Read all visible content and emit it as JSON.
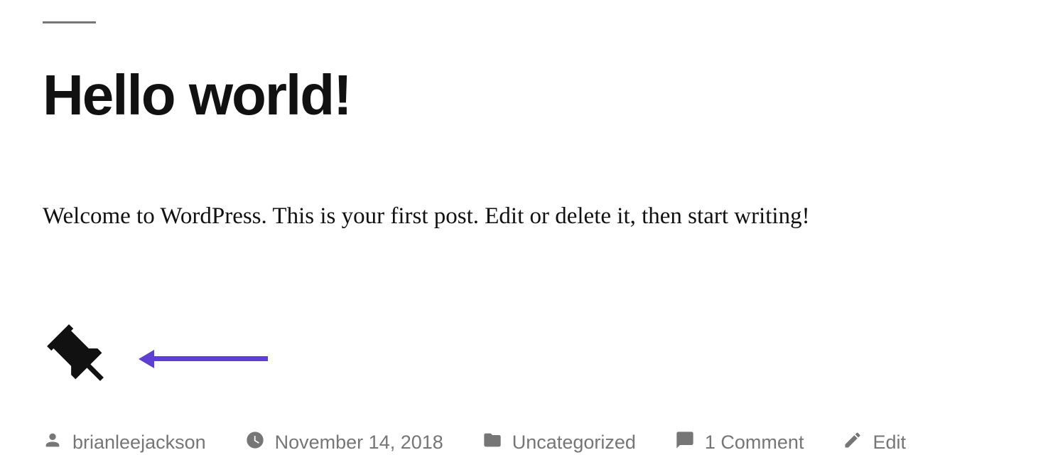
{
  "post": {
    "title": "Hello world!",
    "content": "Welcome to WordPress. This is your first post. Edit or delete it, then start writing!"
  },
  "meta": {
    "author": "brianleejackson",
    "date": "November 14, 2018",
    "category": "Uncategorized",
    "comments": "1 Comment",
    "edit": "Edit"
  },
  "annotation": {
    "arrow_color": "#5d3fd3"
  }
}
